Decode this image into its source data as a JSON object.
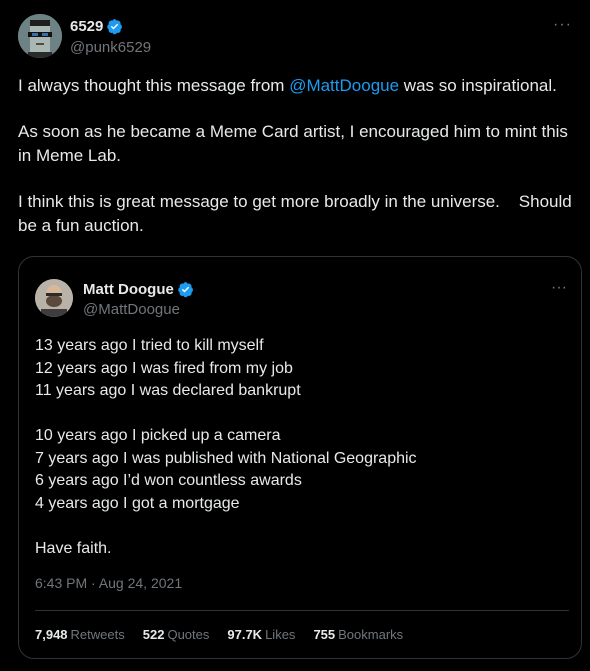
{
  "author": {
    "name": "6529",
    "handle": "@punk6529"
  },
  "tweet": {
    "p1_before": "I always thought this message from ",
    "p1_mention": "@MattDoogue",
    "p1_after": " was so inspirational.",
    "p2": "As soon as he became a Meme Card artist, I encouraged him to mint this in Meme Lab.",
    "p3": "I think this is great message to get more broadly in the universe.    Should be a fun auction."
  },
  "quoted": {
    "name": "Matt Doogue",
    "handle": "@MattDoogue",
    "lines": [
      "13 years ago I tried to kill myself",
      "12 years ago I was fired from my job",
      "11 years ago I was declared bankrupt",
      "",
      "10 years ago I picked up a camera",
      "7 years ago I was published with National Geographic",
      "6 years ago I’d won countless awards",
      "4 years ago I got a mortgage",
      "",
      "Have faith."
    ],
    "timestamp": "6:43 PM · Aug 24, 2021",
    "stats": {
      "retweets_count": "7,948",
      "retweets_label": "Retweets",
      "quotes_count": "522",
      "quotes_label": "Quotes",
      "likes_count": "97.7K",
      "likes_label": "Likes",
      "bookmarks_count": "755",
      "bookmarks_label": "Bookmarks"
    }
  },
  "colors": {
    "background": "#000000",
    "text": "#e7e9ea",
    "secondary": "#71767b",
    "accent": "#1d9bf0",
    "border": "#2f3336"
  },
  "icons": {
    "verified": "verified-badge-icon",
    "more": "more-options-icon"
  }
}
